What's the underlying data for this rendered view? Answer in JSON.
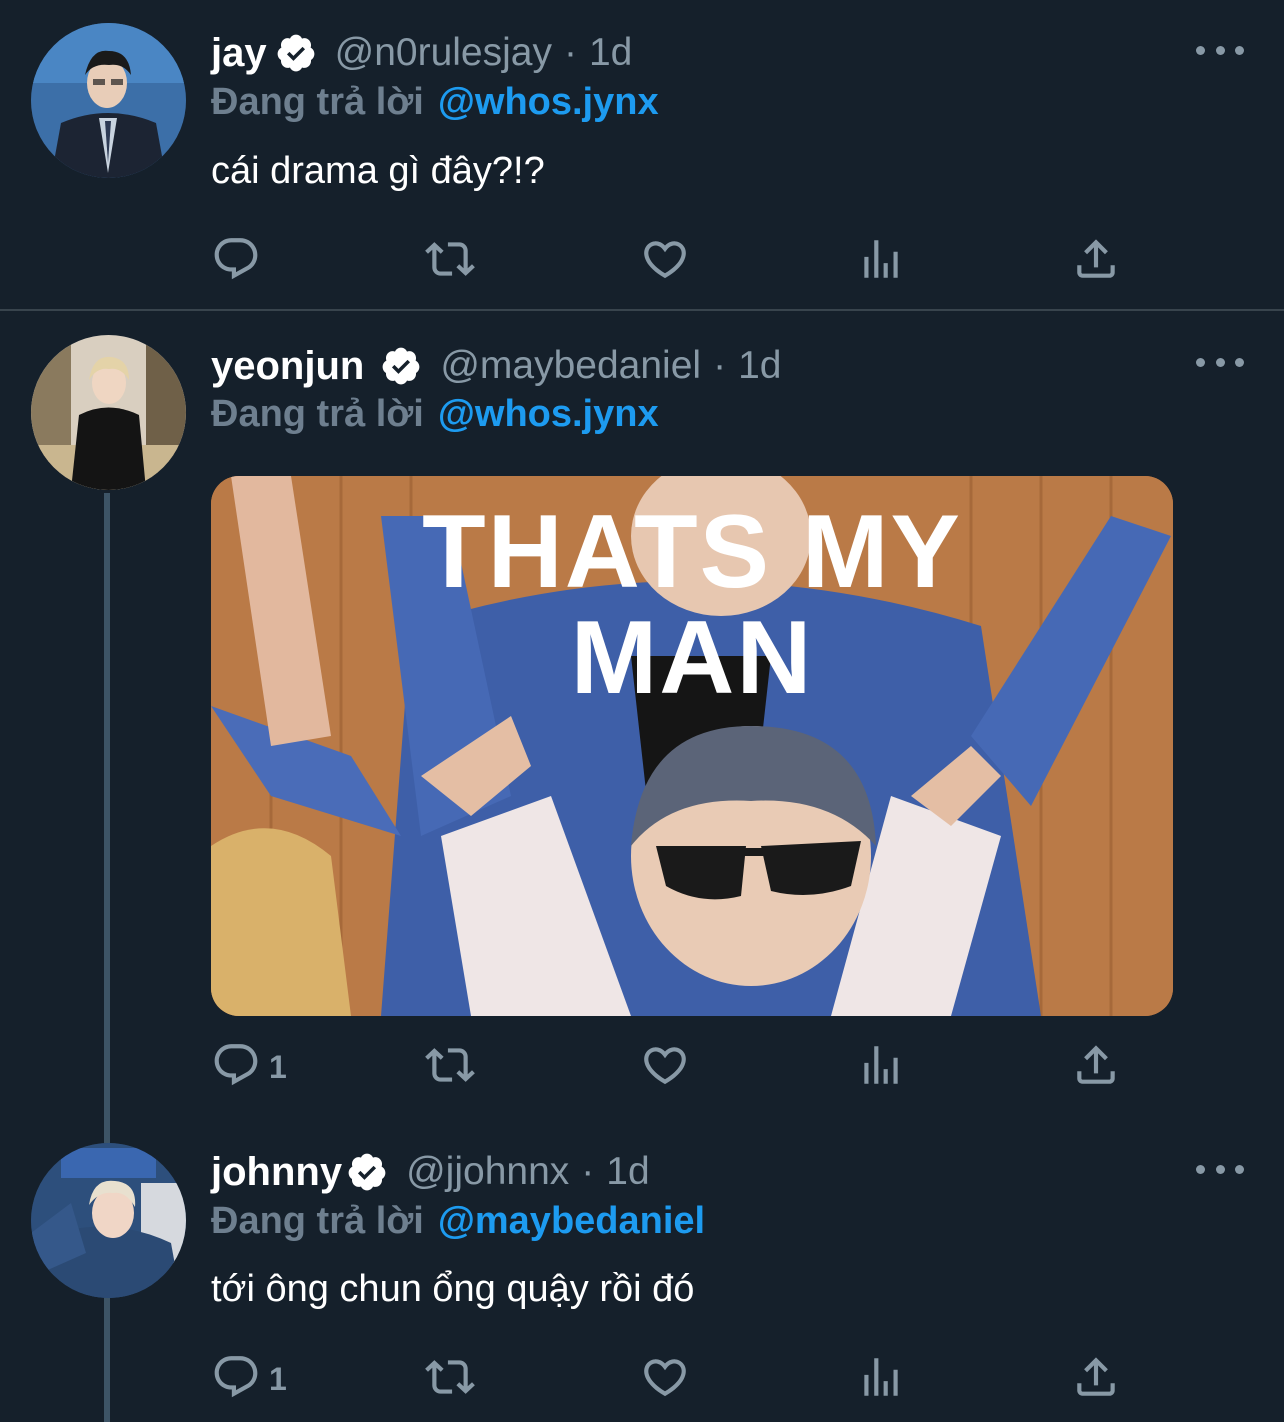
{
  "tweets": [
    {
      "name": "jay",
      "handle": "@n0rulesjay",
      "separator": "·",
      "time": "1d",
      "reply_prefix": "Đang trả lời",
      "reply_to": "@whos.jynx",
      "text": "cái drama gì đây?!?",
      "reply_count": "",
      "verified": true
    },
    {
      "name": "yeonjun",
      "handle": "@maybedaniel",
      "separator": "·",
      "time": "1d",
      "reply_prefix": "Đang trả lời",
      "reply_to": "@whos.jynx",
      "media": {
        "caption_line1": "THATS MY",
        "caption_line2": "MAN"
      },
      "reply_count": "1",
      "verified": true
    },
    {
      "name": "johnny",
      "handle": "@jjohnnx",
      "separator": "·",
      "time": "1d",
      "reply_prefix": "Đang trả lời",
      "reply_to": "@maybedaniel",
      "text": "tới ông chun ổng quậy rồi đó",
      "reply_count": "1",
      "verified": true
    }
  ],
  "icons": {
    "reply": "reply-icon",
    "retweet": "retweet-icon",
    "like": "heart-icon",
    "views": "analytics-icon",
    "share": "share-icon",
    "more": "more-icon",
    "verified": "verified-badge-icon"
  },
  "colors": {
    "background": "#15202b",
    "link": "#1d9bf0",
    "muted": "#8899a6",
    "divider": "#38444d"
  }
}
